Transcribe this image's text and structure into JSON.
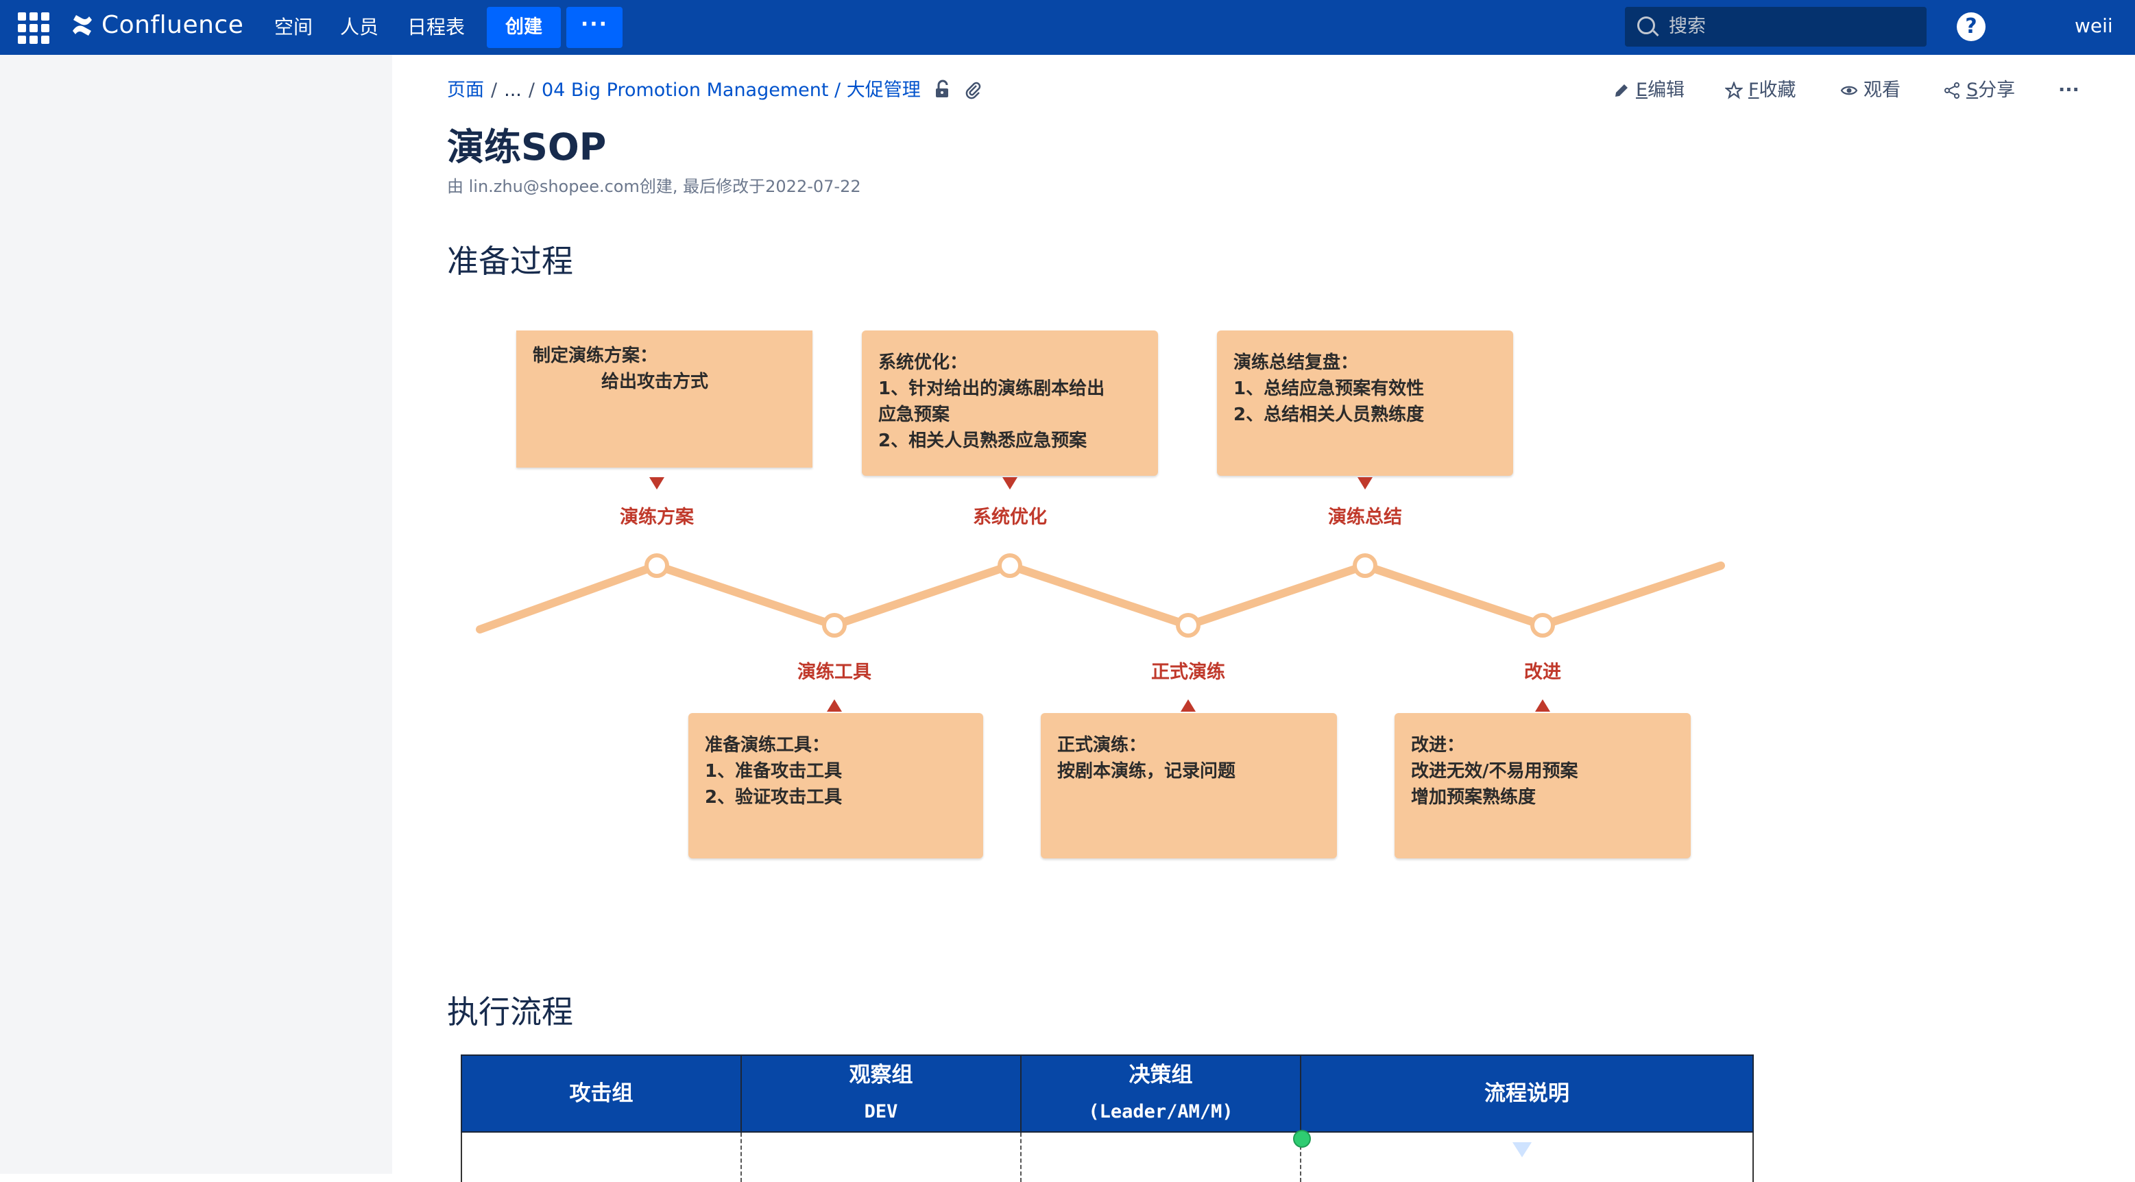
{
  "topnav": {
    "product": "Confluence",
    "items": [
      "空间",
      "人员",
      "日程表"
    ],
    "create_label": "创建",
    "more_label": "···",
    "search_placeholder": "搜索",
    "help_label": "?",
    "user": "weii"
  },
  "breadcrumb": {
    "root": "页面",
    "ellipsis": "...",
    "current": "04 Big Promotion Management / 大促管理"
  },
  "page_actions": [
    {
      "key": "E",
      "label": "编辑",
      "icon": "pencil-icon"
    },
    {
      "key": "F",
      "label": "收藏",
      "icon": "star-icon"
    },
    {
      "key": "",
      "label": "观看",
      "icon": "eye-icon"
    },
    {
      "key": "S",
      "label": "分享",
      "icon": "share-icon"
    },
    {
      "key": "",
      "label": "···",
      "icon": "more-icon"
    }
  ],
  "page": {
    "title": "演练SOP",
    "byline": "由 lin.zhu@shopee.com创建, 最后修改于2022-07-22",
    "section1": "准备过程",
    "section2": "执行流程"
  },
  "diagram": {
    "colors": {
      "box": "#f8c89a",
      "label": "#c0392b",
      "line": "#f6c08e"
    },
    "top_steps": [
      {
        "label": "演练方案",
        "lines": [
          "制定演练方案：",
          "            给出攻击方式"
        ]
      },
      {
        "label": "系统优化",
        "lines": [
          "系统优化：",
          "1、针对给出的演练剧本给出",
          "应急预案",
          "2、相关人员熟悉应急预案"
        ]
      },
      {
        "label": "演练总结",
        "lines": [
          "演练总结复盘：",
          "1、总结应急预案有效性",
          "2、总结相关人员熟练度"
        ]
      }
    ],
    "bottom_steps": [
      {
        "label": "演练工具",
        "lines": [
          "准备演练工具：",
          "1、准备攻击工具",
          "2、验证攻击工具"
        ]
      },
      {
        "label": "正式演练",
        "lines": [
          "正式演练：",
          "按剧本演练，记录问题"
        ]
      },
      {
        "label": "改进",
        "lines": [
          "改进：",
          "改进无效/不易用预案",
          "增加预案熟练度"
        ]
      }
    ]
  },
  "table": {
    "headers": [
      {
        "title": "攻击组",
        "sub": ""
      },
      {
        "title": "观察组",
        "sub": "DEV"
      },
      {
        "title": "决策组",
        "sub": "(Leader/AM/M)"
      },
      {
        "title": "流程说明",
        "sub": ""
      }
    ]
  }
}
